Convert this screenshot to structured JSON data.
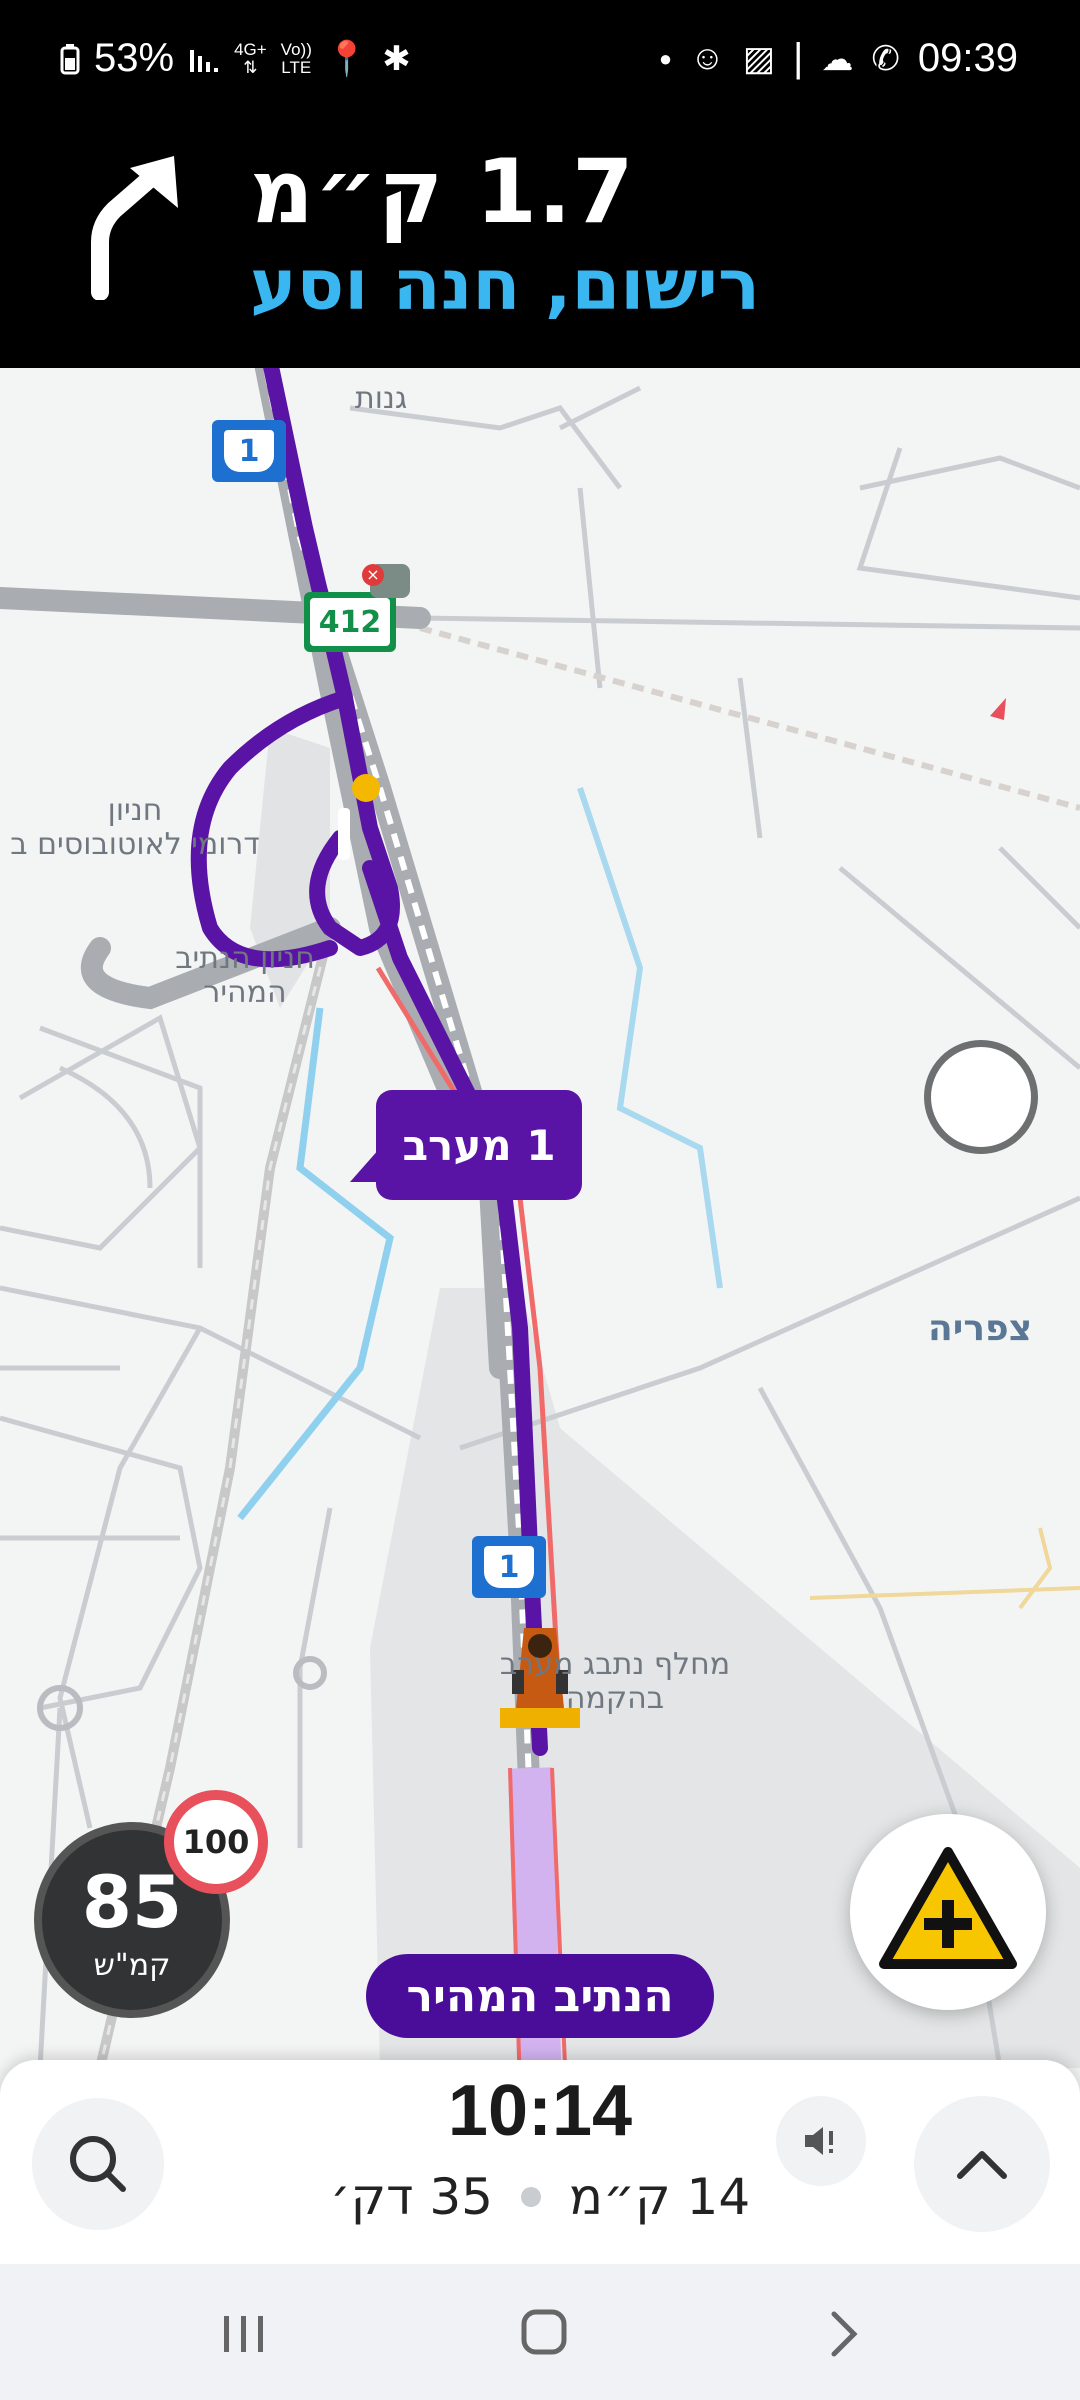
{
  "status_bar": {
    "battery": "53%",
    "network": "4G+",
    "volte_top": "Vo))",
    "volte_bottom": "LTE",
    "time": "09:39"
  },
  "navigation": {
    "distance": "1.7 ק״מ",
    "street": "רישום, חנה וסע",
    "turn_icon": "turn-slight-right-icon"
  },
  "map": {
    "labels": {
      "ganot": "גנות",
      "bus_terminal_line1": "חניון",
      "bus_terminal_line2": "דרומי לאוטובוסים ב",
      "fast_lane_parking_line1": "חניון הנתיב",
      "fast_lane_parking_line2": "המהיר",
      "tzafria": "צפריה",
      "interchange_line1": "מחלף נתבג מערב",
      "interchange_line2": "בהקמה"
    },
    "route_callout": "1 מערב",
    "highway_1": "1",
    "highway_412": "412",
    "route_color": "#5a14a5",
    "traffic_color": "#f06a6a"
  },
  "speed": {
    "current": "85",
    "unit": "קמ\"ש",
    "limit": "100"
  },
  "route_pill": "הנתיב המהיר",
  "bottom_panel": {
    "eta": "10:14",
    "distance": "14 ק״מ",
    "duration": "35 דק׳"
  }
}
